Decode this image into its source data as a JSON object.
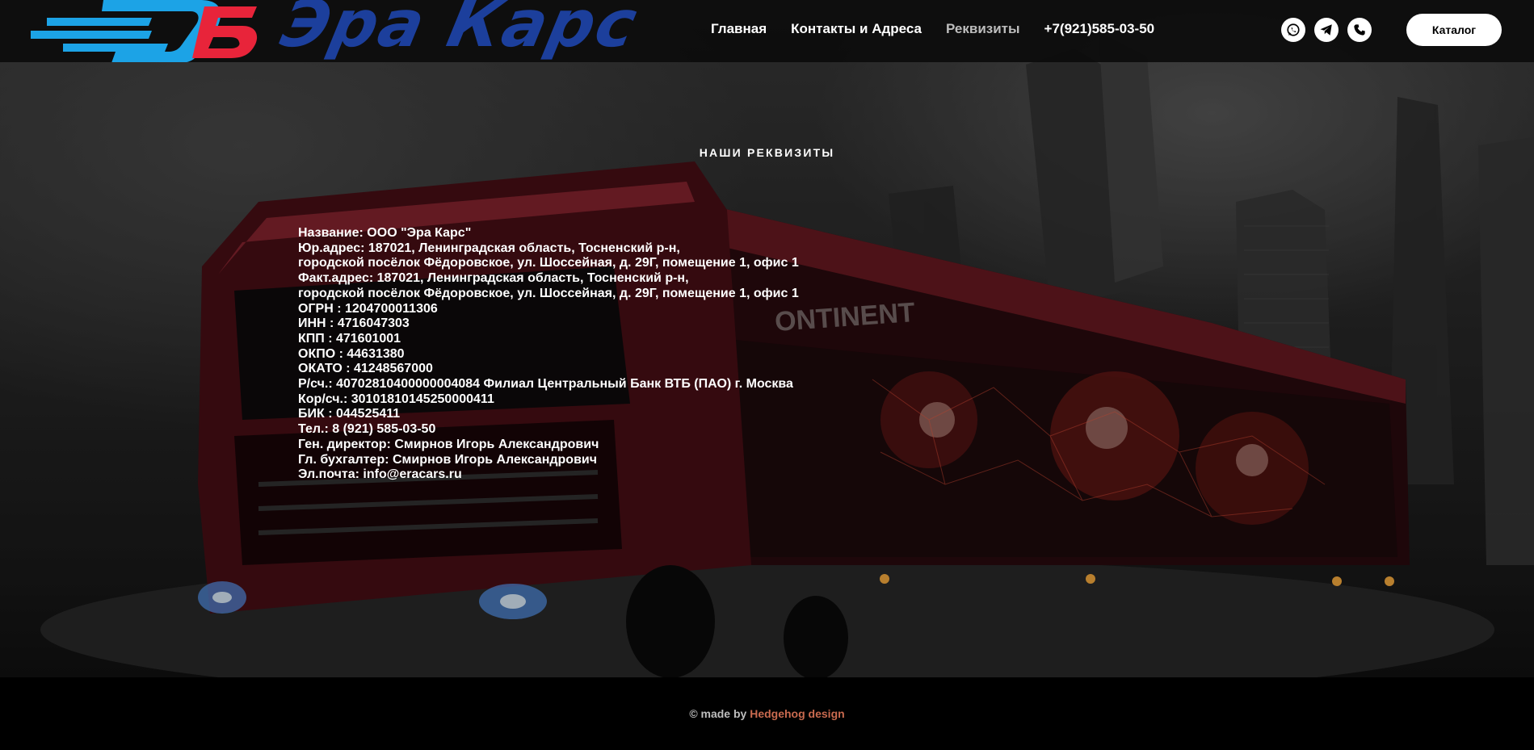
{
  "header": {
    "logo_text": "Эра Карс",
    "logo_letter": "В",
    "nav": [
      {
        "label": "Главная"
      },
      {
        "label": "Контакты и Адреса"
      },
      {
        "label": "Реквизиты"
      },
      {
        "label": "+7(921)585-03-50"
      }
    ],
    "socials": [
      "whatsapp-icon",
      "telegram-icon",
      "phone-icon"
    ],
    "catalog_label": "Каталог"
  },
  "main": {
    "section_title": "НАШИ РЕКВИЗИТЫ",
    "lines": [
      "Название: ООО \"Эра Карс\"",
      "Юр.адрес: 187021, Ленинградская область, Тосненский р-н,",
      "городской посёлок Фёдоровское, ул. Шоссейная, д. 29Г, помещение 1, офис 1",
      "Факт.адрес: 187021, Ленинградская область, Тосненский р-н,",
      "городской посёлок Фёдоровское, ул. Шоссейная, д. 29Г, помещение 1, офис 1",
      "ОГРН : 1204700011306",
      "ИНН : 4716047303",
      "КПП : 471601001",
      "ОКПО : 44631380",
      "ОКАТО : 41248567000",
      "Р/сч.: 40702810400000004084 Филиал Центральный Банк ВТБ (ПАО) г. Москва",
      "Кор/сч.: 30101810145250000411",
      "БИК : 044525411",
      "Тел.: 8 (921) 585-03-50",
      "Ген. директор: Смирнов Игорь Александрович",
      "Гл. бухгалтер: Смирнов Игорь Александрович",
      "Эл.почта: info@eracars.ru"
    ]
  },
  "footer": {
    "prefix": "© made by",
    "link": "Hedgehog design"
  },
  "colors": {
    "logo_blue": "#1ca3e6",
    "logo_red": "#e8243a",
    "logo_text": "#1c3f9c",
    "footer_link": "#c96a4f"
  }
}
